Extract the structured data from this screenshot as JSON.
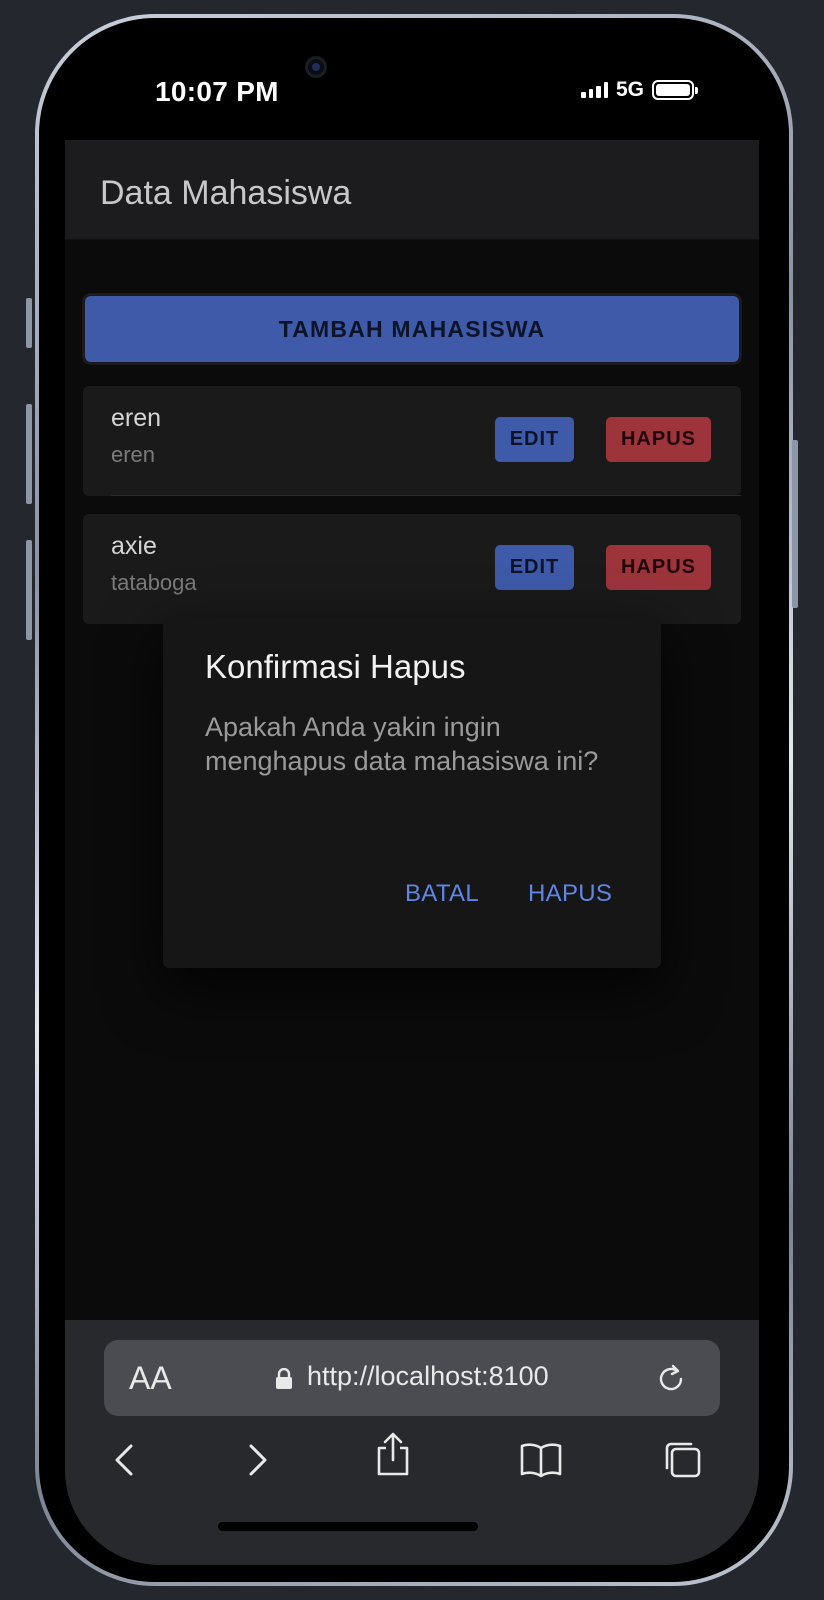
{
  "status_bar": {
    "time": "10:07 PM",
    "network": "5G"
  },
  "header": {
    "title": "Data Mahasiswa"
  },
  "toolbar": {
    "add_label": "TAMBAH MAHASISWA"
  },
  "students": [
    {
      "name": "eren",
      "sub": "eren",
      "edit_label": "EDIT",
      "delete_label": "HAPUS"
    },
    {
      "name": "axie",
      "sub": "tataboga",
      "edit_label": "EDIT",
      "delete_label": "HAPUS"
    }
  ],
  "dialog": {
    "title": "Konfirmasi Hapus",
    "message": "Apakah Anda yakin ingin menghapus data mahasiswa ini?",
    "cancel_label": "BATAL",
    "confirm_label": "HAPUS"
  },
  "browser": {
    "text_size_label": "AA",
    "url": "http://localhost:8100"
  },
  "colors": {
    "primary": "#3e5aa8",
    "danger": "#9d343c",
    "link": "#5f86e6"
  },
  "icons": [
    "lock-icon",
    "reload-icon",
    "back-icon",
    "forward-icon",
    "share-icon",
    "bookmarks-icon",
    "tabs-icon"
  ]
}
